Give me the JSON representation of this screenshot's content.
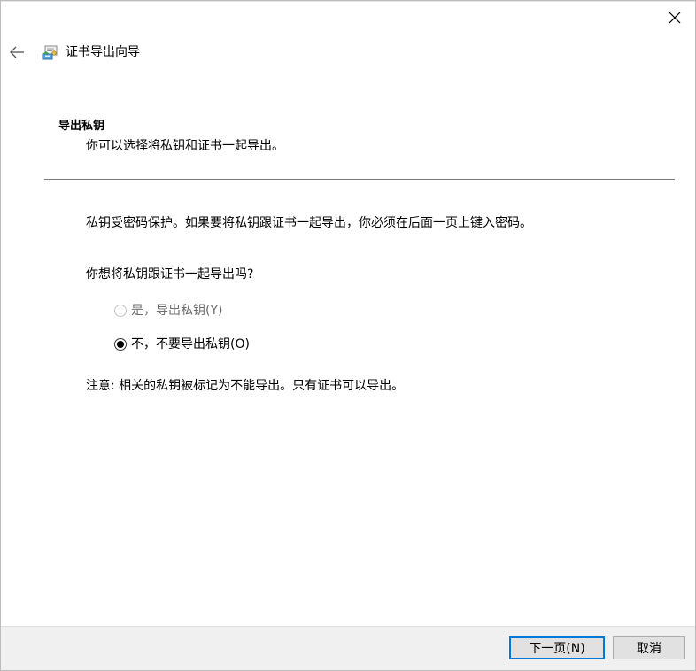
{
  "window": {
    "title": "证书导出向导"
  },
  "header": {
    "section_title": "导出私钥",
    "section_subtitle": "你可以选择将私钥和证书一起导出。"
  },
  "content": {
    "info_text": "私钥受密码保护。如果要将私钥跟证书一起导出，你必须在后面一页上键入密码。",
    "question": "你想将私钥跟证书一起导出吗?",
    "options": [
      {
        "label": "是，导出私钥(Y)",
        "selected": false,
        "enabled": false
      },
      {
        "label": "不，不要导出私钥(O)",
        "selected": true,
        "enabled": true
      }
    ],
    "note": "注意: 相关的私钥被标记为不能导出。只有证书可以导出。"
  },
  "footer": {
    "next_label": "下一页(N)",
    "cancel_label": "取消"
  },
  "icons": {
    "back": "back-arrow-icon",
    "close": "close-icon",
    "wizard": "certificate-wizard-icon"
  },
  "colors": {
    "accent": "#0078d7",
    "footer_bg": "#f0f0f0",
    "divider": "#7a7a7a"
  }
}
